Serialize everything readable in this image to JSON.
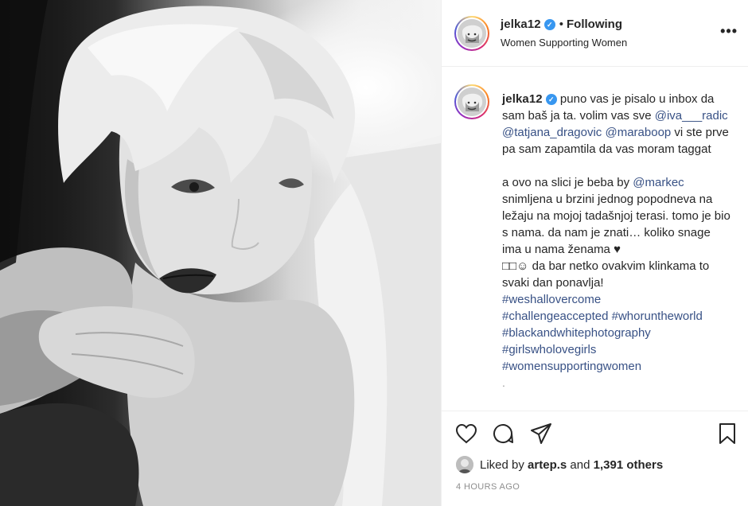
{
  "post": {
    "username": "jelka12",
    "follow_sep": "•",
    "follow_status": "Following",
    "subtitle": "Women Supporting Women",
    "more_label": "•••"
  },
  "caption": {
    "username": "jelka12",
    "text_1": " puno vas je pisalo u inbox da sam baš ja ta. volim vas sve ",
    "mention_1": "@iva___radic",
    "mention_2": "@tatjana_dragovic",
    "mention_3": "@maraboop",
    "text_2": " vi ste prve pa sam zapamtila da vas moram taggat\n\na ovo na slici je beba by ",
    "mention_4": "@markec",
    "text_3": "\nsnimljena u brzini jednog popodneva na ležaju na mojoj tadašnjoj terasi. tomo je bio s nama. da nam je znati… koliko snage ima u nama ženama ♥\n□□☺ da bar netko ovakvim klinkama to svaki dan ponavlja!\n",
    "hashtag_1": "#weshallovercome",
    "hashtag_2": "#challengeaccepted",
    "hashtag_3": "#whoruntheworld",
    "hashtag_4": "#blackandwhitephotography",
    "hashtag_5": "#girlswholovegirls",
    "hashtag_6": "#womensupportingwomen",
    "trail": "."
  },
  "likes": {
    "prefix": "Liked by",
    "user": "artep.s",
    "middle": "and",
    "count": "1,391 others"
  },
  "timestamp": "4 HOURS AGO",
  "icons": [
    "heart-icon",
    "comment-icon",
    "share-icon",
    "save-icon",
    "verified-badge-icon",
    "more-options-icon"
  ],
  "colors": {
    "link": "#385185",
    "verified": "#3897f0",
    "muted": "#8e8e8e",
    "border": "#efefef"
  }
}
